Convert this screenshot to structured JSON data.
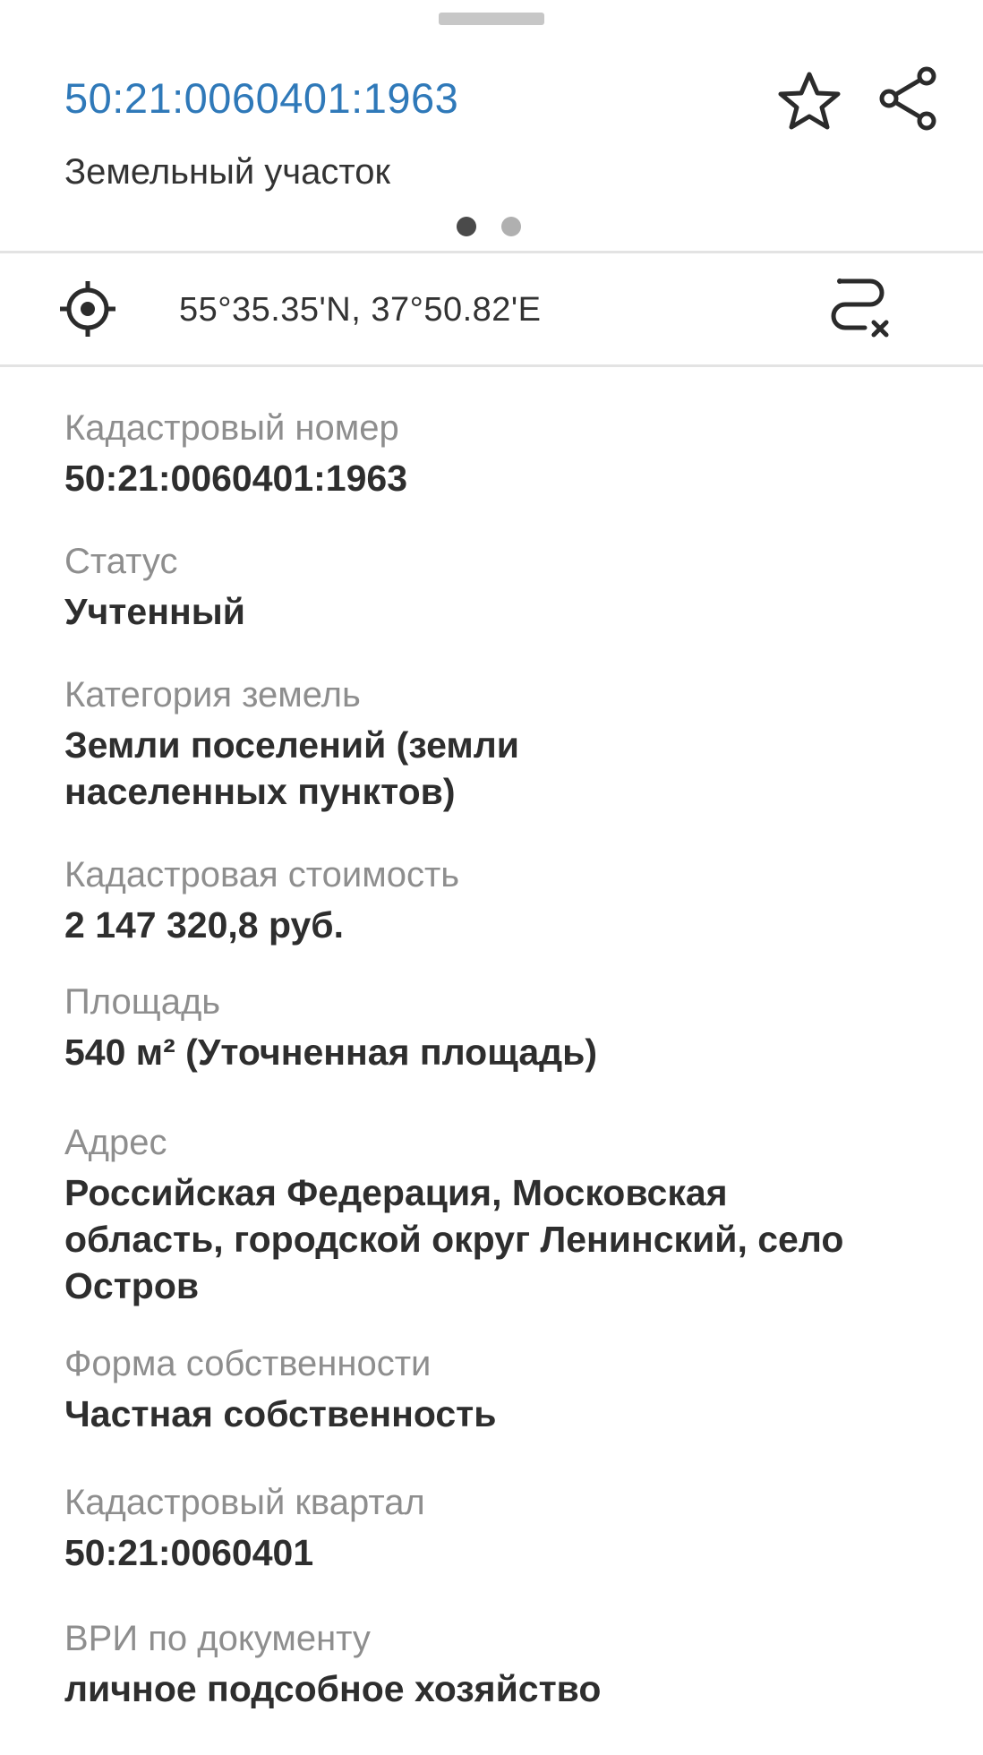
{
  "header": {
    "title": "50:21:0060401:1963",
    "subtitle": "Земельный участок",
    "favorite_icon": "star-outline-icon",
    "share_icon": "share-icon",
    "pager": {
      "count": 2,
      "active": 1
    }
  },
  "coordinates": {
    "text": "55°35.35'N, 37°50.82'E",
    "locate_icon": "crosshair-icon",
    "route_icon": "route-clear-icon"
  },
  "fields": [
    {
      "label": "Кадастровый номер",
      "value": "50:21:0060401:1963"
    },
    {
      "label": "Статус",
      "value": "Учтенный"
    },
    {
      "label": "Категория земель",
      "value": "Земли поселений (земли\nнаселенных пунктов)"
    },
    {
      "label": "Кадастровая стоимость",
      "value": "2 147 320,8 руб."
    },
    {
      "label": "Площадь",
      "value": "540 м² (Уточненная площадь)"
    },
    {
      "label": "Адрес",
      "value": "Российская Федерация, Московская\nобласть, городской округ Ленинский, село\nОстров"
    },
    {
      "label": "Форма собственности",
      "value": "Частная собственность"
    },
    {
      "label": "Кадастровый квартал",
      "value": "50:21:0060401"
    },
    {
      "label": "ВРИ по документу",
      "value": "личное подсобное хозяйство"
    }
  ],
  "colors": {
    "accent": "#2f79b9",
    "label": "#8e8e8e",
    "value": "#2e2e2e",
    "divider": "#e3e3e3"
  }
}
